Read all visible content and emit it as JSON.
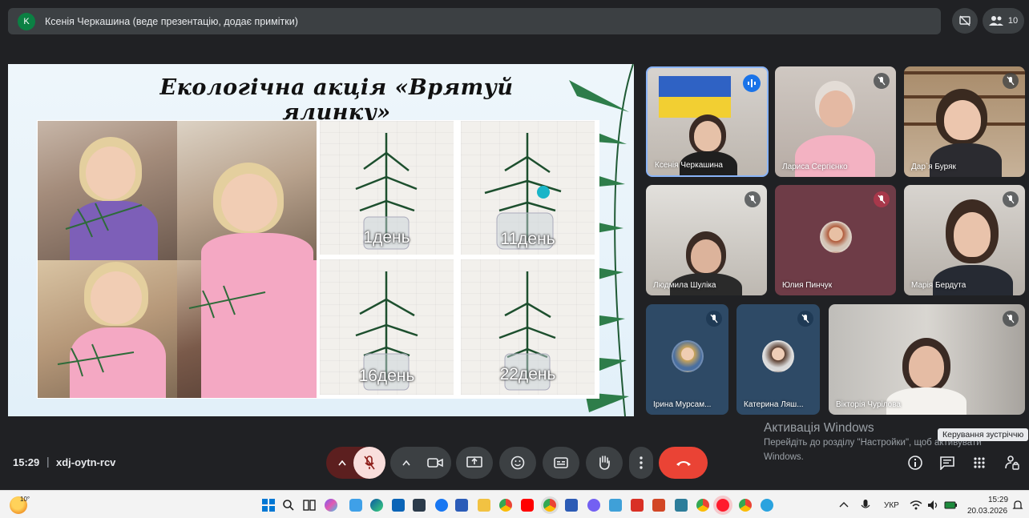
{
  "top_bar": {
    "avatar_letter": "K",
    "presenter_text": "Ксенія Черкашина (веде презентацію, додає примітки)",
    "participant_count": "10"
  },
  "slide": {
    "title": "Екологічна акція «Врятуй ялинку»",
    "day_labels": [
      "1день",
      "11день",
      "16день",
      "22день"
    ]
  },
  "participants": [
    {
      "name": "Ксенія Черкашина",
      "speaking": true
    },
    {
      "name": "Лариса Сергієнко",
      "speaking": false
    },
    {
      "name": "Дар`я Буряк",
      "speaking": false
    },
    {
      "name": "Людмила Шуліка",
      "speaking": false
    },
    {
      "name": "Юлия Пинчук",
      "speaking": false
    },
    {
      "name": "Марія Бердута",
      "speaking": false
    },
    {
      "name": "Ірина Мурсам...",
      "speaking": false
    },
    {
      "name": "Катерина Ляш...",
      "speaking": false
    },
    {
      "name": "Вікторія Чурілова",
      "speaking": false
    }
  ],
  "watermark": {
    "title": "Активація Windows",
    "line1": "Перейдіть до розділу \"Настройки\", щоб активувати",
    "line2": "Windows."
  },
  "tooltip": "Керування зустріччю",
  "bottom_bar": {
    "time": "15:29",
    "separator": "|",
    "meeting_code": "xdj-oytn-rcv"
  },
  "taskbar": {
    "weather_temp": "10°",
    "language": "УКР",
    "time": "15:29",
    "date": "20.03.2026"
  },
  "colors": {
    "background": "#202124",
    "end_call": "#ea4335",
    "mic_off": "#f9dedc",
    "speaking": "#1a73e8"
  }
}
